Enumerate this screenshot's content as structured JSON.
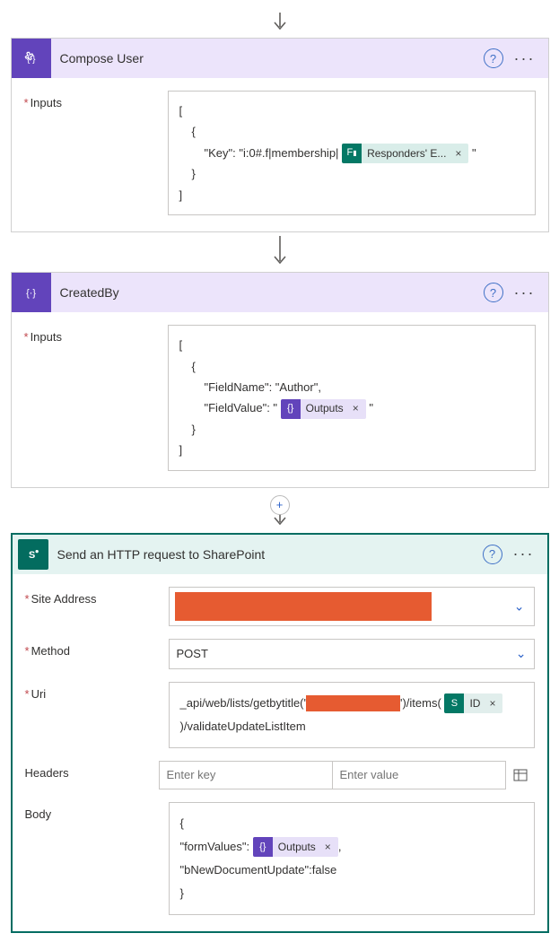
{
  "compose_user": {
    "title": "Compose User",
    "inputs_label": "Inputs",
    "code": {
      "open_arr": "[",
      "open_obj": "{",
      "key_prefix": "\"Key\": \"i:0#.f|membership|",
      "token_label": "Responders' E...",
      "key_suffix": "\"",
      "close_obj": "}",
      "close_arr": "]"
    }
  },
  "created_by": {
    "title": "CreatedBy",
    "inputs_label": "Inputs",
    "code": {
      "open_arr": "[",
      "open_obj": "{",
      "fieldname": "\"FieldName\": \"Author\",",
      "fieldvalue_prefix": "\"FieldValue\": \"",
      "token_label": "Outputs",
      "fieldvalue_suffix": "\"",
      "close_obj": "}",
      "close_arr": "]"
    }
  },
  "sp_http": {
    "title": "Send an HTTP request to SharePoint",
    "labels": {
      "site": "Site Address",
      "method": "Method",
      "uri": "Uri",
      "headers": "Headers",
      "body": "Body"
    },
    "method_value": "POST",
    "uri": {
      "prefix": "_api/web/lists/getbytitle('",
      "mid": "')/items(",
      "token_label": "ID",
      "suffix": ")/validateUpdateListItem"
    },
    "headers_key_ph": "Enter key",
    "headers_val_ph": "Enter value",
    "body": {
      "open": "{",
      "fv_prefix": "\"formValues\":",
      "token_label": "Outputs",
      "fv_suffix": ",",
      "bnew": "\"bNewDocumentUpdate\":false",
      "close": "}"
    }
  }
}
